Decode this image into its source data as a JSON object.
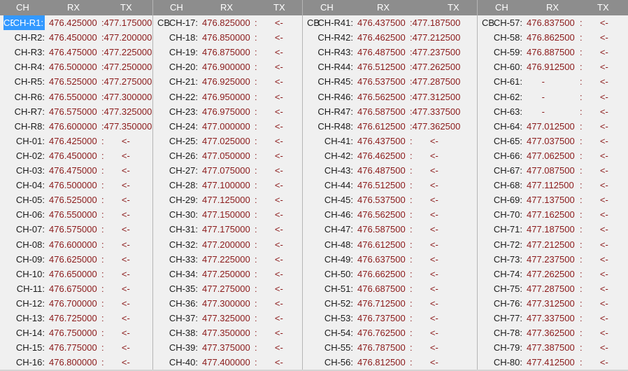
{
  "headers": {
    "ch": "CH",
    "rx": "RX",
    "tx": "TX"
  },
  "panels": [
    {
      "rows": [
        {
          "cb": "CB",
          "ch": "CH-R1:",
          "rx": "476.425000",
          "tx": ":477.175000",
          "selected": true
        },
        {
          "cb": "",
          "ch": "CH-R2:",
          "rx": "476.450000",
          "tx": ":477.200000"
        },
        {
          "cb": "",
          "ch": "CH-R3:",
          "rx": "476.475000",
          "tx": ":477.225000"
        },
        {
          "cb": "",
          "ch": "CH-R4:",
          "rx": "476.500000",
          "tx": ":477.250000"
        },
        {
          "cb": "",
          "ch": "CH-R5:",
          "rx": "476.525000",
          "tx": ":477.275000"
        },
        {
          "cb": "",
          "ch": "CH-R6:",
          "rx": "476.550000",
          "tx": ":477.300000"
        },
        {
          "cb": "",
          "ch": "CH-R7:",
          "rx": "476.575000",
          "tx": ":477.325000"
        },
        {
          "cb": "",
          "ch": "CH-R8:",
          "rx": "476.600000",
          "tx": ":477.350000"
        },
        {
          "cb": "",
          "ch": "CH-01:",
          "rx": "476.425000",
          "tx": ":       <-"
        },
        {
          "cb": "",
          "ch": "CH-02:",
          "rx": "476.450000",
          "tx": ":       <-"
        },
        {
          "cb": "",
          "ch": "CH-03:",
          "rx": "476.475000",
          "tx": ":       <-"
        },
        {
          "cb": "",
          "ch": "CH-04:",
          "rx": "476.500000",
          "tx": ":       <-"
        },
        {
          "cb": "",
          "ch": "CH-05:",
          "rx": "476.525000",
          "tx": ":       <-"
        },
        {
          "cb": "",
          "ch": "CH-06:",
          "rx": "476.550000",
          "tx": ":       <-"
        },
        {
          "cb": "",
          "ch": "CH-07:",
          "rx": "476.575000",
          "tx": ":       <-"
        },
        {
          "cb": "",
          "ch": "CH-08:",
          "rx": "476.600000",
          "tx": ":       <-"
        },
        {
          "cb": "",
          "ch": "CH-09:",
          "rx": "476.625000",
          "tx": ":       <-"
        },
        {
          "cb": "",
          "ch": "CH-10:",
          "rx": "476.650000",
          "tx": ":       <-"
        },
        {
          "cb": "",
          "ch": "CH-11:",
          "rx": "476.675000",
          "tx": ":       <-"
        },
        {
          "cb": "",
          "ch": "CH-12:",
          "rx": "476.700000",
          "tx": ":       <-"
        },
        {
          "cb": "",
          "ch": "CH-13:",
          "rx": "476.725000",
          "tx": ":       <-"
        },
        {
          "cb": "",
          "ch": "CH-14:",
          "rx": "476.750000",
          "tx": ":       <-"
        },
        {
          "cb": "",
          "ch": "CH-15:",
          "rx": "476.775000",
          "tx": ":       <-"
        },
        {
          "cb": "",
          "ch": "CH-16:",
          "rx": "476.800000",
          "tx": ":       <-"
        }
      ]
    },
    {
      "rows": [
        {
          "cb": "CB",
          "ch": "CH-17:",
          "rx": "476.825000",
          "tx": ":       <-"
        },
        {
          "cb": "",
          "ch": "CH-18:",
          "rx": "476.850000",
          "tx": ":       <-"
        },
        {
          "cb": "",
          "ch": "CH-19:",
          "rx": "476.875000",
          "tx": ":       <-"
        },
        {
          "cb": "",
          "ch": "CH-20:",
          "rx": "476.900000",
          "tx": ":       <-"
        },
        {
          "cb": "",
          "ch": "CH-21:",
          "rx": "476.925000",
          "tx": ":       <-"
        },
        {
          "cb": "",
          "ch": "CH-22:",
          "rx": "476.950000",
          "tx": ":       <-"
        },
        {
          "cb": "",
          "ch": "CH-23:",
          "rx": "476.975000",
          "tx": ":       <-"
        },
        {
          "cb": "",
          "ch": "CH-24:",
          "rx": "477.000000",
          "tx": ":       <-"
        },
        {
          "cb": "",
          "ch": "CH-25:",
          "rx": "477.025000",
          "tx": ":       <-"
        },
        {
          "cb": "",
          "ch": "CH-26:",
          "rx": "477.050000",
          "tx": ":       <-"
        },
        {
          "cb": "",
          "ch": "CH-27:",
          "rx": "477.075000",
          "tx": ":       <-"
        },
        {
          "cb": "",
          "ch": "CH-28:",
          "rx": "477.100000",
          "tx": ":       <-"
        },
        {
          "cb": "",
          "ch": "CH-29:",
          "rx": "477.125000",
          "tx": ":       <-"
        },
        {
          "cb": "",
          "ch": "CH-30:",
          "rx": "477.150000",
          "tx": ":       <-"
        },
        {
          "cb": "",
          "ch": "CH-31:",
          "rx": "477.175000",
          "tx": ":       <-"
        },
        {
          "cb": "",
          "ch": "CH-32:",
          "rx": "477.200000",
          "tx": ":       <-"
        },
        {
          "cb": "",
          "ch": "CH-33:",
          "rx": "477.225000",
          "tx": ":       <-"
        },
        {
          "cb": "",
          "ch": "CH-34:",
          "rx": "477.250000",
          "tx": ":       <-"
        },
        {
          "cb": "",
          "ch": "CH-35:",
          "rx": "477.275000",
          "tx": ":       <-"
        },
        {
          "cb": "",
          "ch": "CH-36:",
          "rx": "477.300000",
          "tx": ":       <-"
        },
        {
          "cb": "",
          "ch": "CH-37:",
          "rx": "477.325000",
          "tx": ":       <-"
        },
        {
          "cb": "",
          "ch": "CH-38:",
          "rx": "477.350000",
          "tx": ":       <-"
        },
        {
          "cb": "",
          "ch": "CH-39:",
          "rx": "477.375000",
          "tx": ":       <-"
        },
        {
          "cb": "",
          "ch": "CH-40:",
          "rx": "477.400000",
          "tx": ":       <-"
        }
      ]
    },
    {
      "rows": [
        {
          "cb": "CB",
          "ch": "CH-R41:",
          "rx": "476.437500",
          "tx": ":477.187500"
        },
        {
          "cb": "",
          "ch": "CH-R42:",
          "rx": "476.462500",
          "tx": ":477.212500"
        },
        {
          "cb": "",
          "ch": "CH-R43:",
          "rx": "476.487500",
          "tx": ":477.237500"
        },
        {
          "cb": "",
          "ch": "CH-R44:",
          "rx": "476.512500",
          "tx": ":477.262500"
        },
        {
          "cb": "",
          "ch": "CH-R45:",
          "rx": "476.537500",
          "tx": ":477.287500"
        },
        {
          "cb": "",
          "ch": "CH-R46:",
          "rx": "476.562500",
          "tx": ":477.312500"
        },
        {
          "cb": "",
          "ch": "CH-R47:",
          "rx": "476.587500",
          "tx": ":477.337500"
        },
        {
          "cb": "",
          "ch": "CH-R48:",
          "rx": "476.612500",
          "tx": ":477.362500"
        },
        {
          "cb": "",
          "ch": "CH-41:",
          "rx": "476.437500",
          "tx": ":       <-"
        },
        {
          "cb": "",
          "ch": "CH-42:",
          "rx": "476.462500",
          "tx": ":       <-"
        },
        {
          "cb": "",
          "ch": "CH-43:",
          "rx": "476.487500",
          "tx": ":       <-"
        },
        {
          "cb": "",
          "ch": "CH-44:",
          "rx": "476.512500",
          "tx": ":       <-"
        },
        {
          "cb": "",
          "ch": "CH-45:",
          "rx": "476.537500",
          "tx": ":       <-"
        },
        {
          "cb": "",
          "ch": "CH-46:",
          "rx": "476.562500",
          "tx": ":       <-"
        },
        {
          "cb": "",
          "ch": "CH-47:",
          "rx": "476.587500",
          "tx": ":       <-"
        },
        {
          "cb": "",
          "ch": "CH-48:",
          "rx": "476.612500",
          "tx": ":       <-"
        },
        {
          "cb": "",
          "ch": "CH-49:",
          "rx": "476.637500",
          "tx": ":       <-"
        },
        {
          "cb": "",
          "ch": "CH-50:",
          "rx": "476.662500",
          "tx": ":       <-"
        },
        {
          "cb": "",
          "ch": "CH-51:",
          "rx": "476.687500",
          "tx": ":       <-"
        },
        {
          "cb": "",
          "ch": "CH-52:",
          "rx": "476.712500",
          "tx": ":       <-"
        },
        {
          "cb": "",
          "ch": "CH-53:",
          "rx": "476.737500",
          "tx": ":       <-"
        },
        {
          "cb": "",
          "ch": "CH-54:",
          "rx": "476.762500",
          "tx": ":       <-"
        },
        {
          "cb": "",
          "ch": "CH-55:",
          "rx": "476.787500",
          "tx": ":       <-"
        },
        {
          "cb": "",
          "ch": "CH-56:",
          "rx": "476.812500",
          "tx": ":       <-"
        }
      ]
    },
    {
      "rows": [
        {
          "cb": "CB",
          "ch": "CH-57:",
          "rx": "476.837500",
          "tx": ":       <-"
        },
        {
          "cb": "",
          "ch": "CH-58:",
          "rx": "476.862500",
          "tx": ":       <-"
        },
        {
          "cb": "",
          "ch": "CH-59:",
          "rx": "476.887500",
          "tx": ":       <-"
        },
        {
          "cb": "",
          "ch": "CH-60:",
          "rx": "476.912500",
          "tx": ":       <-"
        },
        {
          "cb": "",
          "ch": "CH-61:",
          "rx": "      -",
          "tx": ":       <-"
        },
        {
          "cb": "",
          "ch": "CH-62:",
          "rx": "      -",
          "tx": ":       <-"
        },
        {
          "cb": "",
          "ch": "CH-63:",
          "rx": "      -",
          "tx": ":       <-"
        },
        {
          "cb": "",
          "ch": "CH-64:",
          "rx": "477.012500",
          "tx": ":       <-"
        },
        {
          "cb": "",
          "ch": "CH-65:",
          "rx": "477.037500",
          "tx": ":       <-"
        },
        {
          "cb": "",
          "ch": "CH-66:",
          "rx": "477.062500",
          "tx": ":       <-"
        },
        {
          "cb": "",
          "ch": "CH-67:",
          "rx": "477.087500",
          "tx": ":       <-"
        },
        {
          "cb": "",
          "ch": "CH-68:",
          "rx": "477.112500",
          "tx": ":       <-"
        },
        {
          "cb": "",
          "ch": "CH-69:",
          "rx": "477.137500",
          "tx": ":       <-"
        },
        {
          "cb": "",
          "ch": "CH-70:",
          "rx": "477.162500",
          "tx": ":       <-"
        },
        {
          "cb": "",
          "ch": "CH-71:",
          "rx": "477.187500",
          "tx": ":       <-"
        },
        {
          "cb": "",
          "ch": "CH-72:",
          "rx": "477.212500",
          "tx": ":       <-"
        },
        {
          "cb": "",
          "ch": "CH-73:",
          "rx": "477.237500",
          "tx": ":       <-"
        },
        {
          "cb": "",
          "ch": "CH-74:",
          "rx": "477.262500",
          "tx": ":       <-"
        },
        {
          "cb": "",
          "ch": "CH-75:",
          "rx": "477.287500",
          "tx": ":       <-"
        },
        {
          "cb": "",
          "ch": "CH-76:",
          "rx": "477.312500",
          "tx": ":       <-"
        },
        {
          "cb": "",
          "ch": "CH-77:",
          "rx": "477.337500",
          "tx": ":       <-"
        },
        {
          "cb": "",
          "ch": "CH-78:",
          "rx": "477.362500",
          "tx": ":       <-"
        },
        {
          "cb": "",
          "ch": "CH-79:",
          "rx": "477.387500",
          "tx": ":       <-"
        },
        {
          "cb": "",
          "ch": "CH-80:",
          "rx": "477.412500",
          "tx": ":       <-"
        }
      ]
    }
  ]
}
